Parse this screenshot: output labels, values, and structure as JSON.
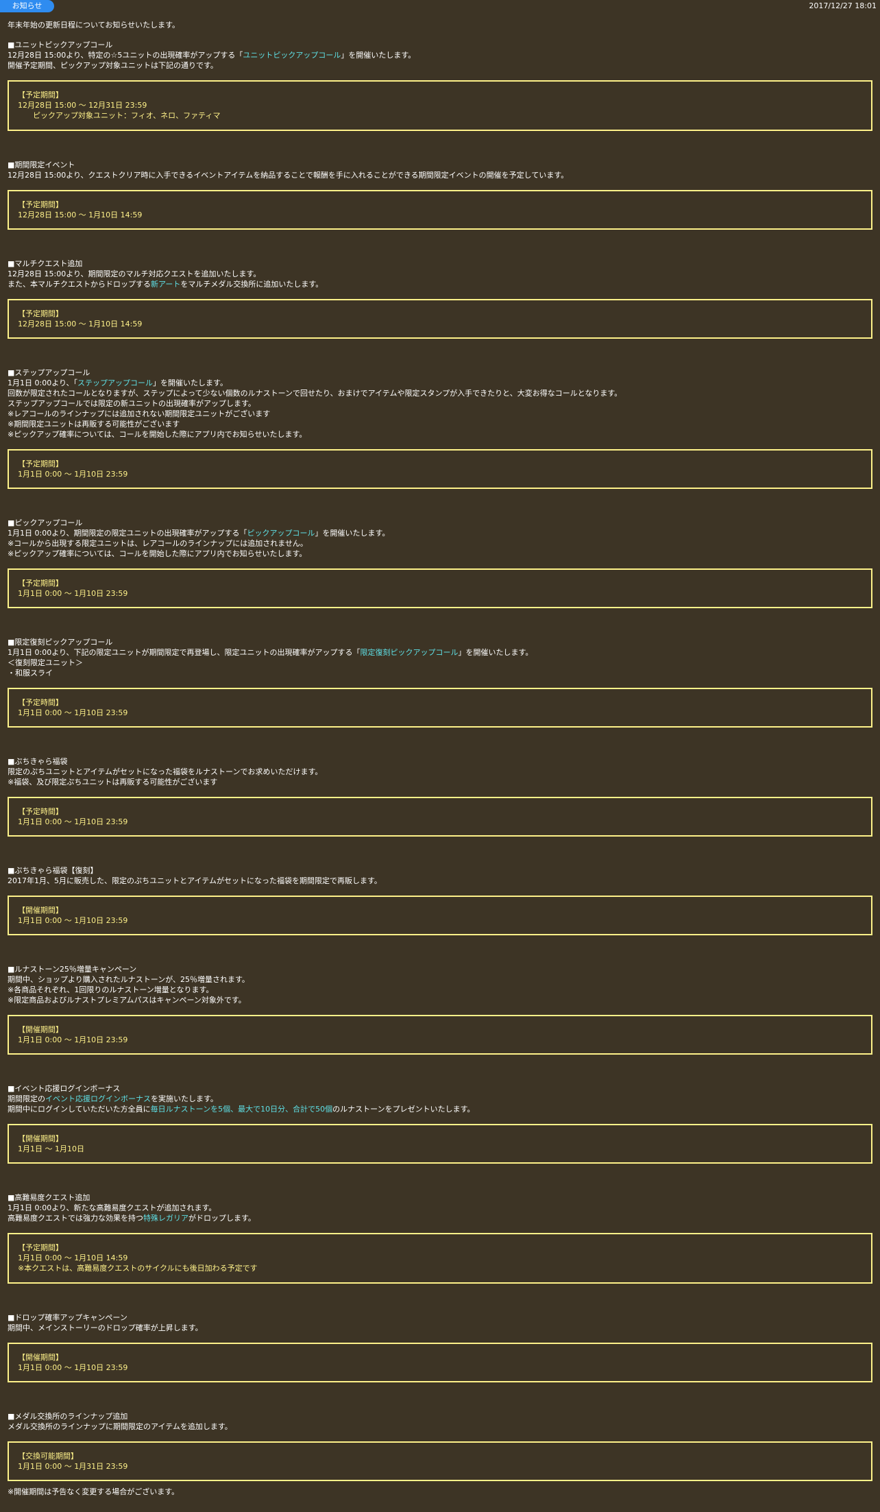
{
  "header": {
    "badge": "お知らせ",
    "timestamp": "2017/12/27 18:01"
  },
  "intro": "年末年始の更新日程についてお知らせいたします。",
  "sections": [
    {
      "title": "■ユニットピックアップコール",
      "lines": [
        [
          {
            "t": "12月28日 15:00より、特定の☆5ユニットの出現確率がアップする「"
          },
          {
            "t": "ユニットピックアップコール",
            "hl": true
          },
          {
            "t": "」を開催いたします。"
          }
        ],
        [
          {
            "t": "開催予定期間、ピックアップ対象ユニットは下記の通りです。"
          }
        ]
      ],
      "box": [
        {
          "t": "【予定期間】"
        },
        {
          "t": "12月28日 15:00 ～ 12月31日 23:59"
        },
        {
          "t": "ピックアップ対象ユニット：フィオ、ネロ、ファティマ",
          "indent": true
        }
      ]
    },
    {
      "title": "■期間限定イベント",
      "lines": [
        [
          {
            "t": "12月28日 15:00より、クエストクリア時に入手できるイベントアイテムを納品することで報酬を手に入れることができる期間限定イベントの開催を予定しています。"
          }
        ]
      ],
      "box": [
        {
          "t": "【予定期間】"
        },
        {
          "t": "12月28日 15:00 ～ 1月10日 14:59"
        }
      ]
    },
    {
      "title": "■マルチクエスト追加",
      "lines": [
        [
          {
            "t": "12月28日 15:00より、期間限定のマルチ対応クエストを追加いたします。"
          }
        ],
        [
          {
            "t": "また、本マルチクエストからドロップする"
          },
          {
            "t": "新アート",
            "hl": true
          },
          {
            "t": "をマルチメダル交換所に追加いたします。"
          }
        ]
      ],
      "box": [
        {
          "t": "【予定期間】"
        },
        {
          "t": "12月28日 15:00 ～ 1月10日 14:59"
        }
      ]
    },
    {
      "title": "■ステップアップコール",
      "lines": [
        [
          {
            "t": "1月1日 0:00より、「"
          },
          {
            "t": "ステップアップコール",
            "hl": true
          },
          {
            "t": "」を開催いたします。"
          }
        ],
        [
          {
            "t": "回数が限定されたコールとなりますが、ステップによって少ない個数のルナストーンで回せたり、おまけでアイテムや限定スタンプが入手できたりと、大変お得なコールとなります。"
          }
        ],
        [
          {
            "t": "ステップアップコールでは限定の新ユニットの出現確率がアップします。"
          }
        ],
        [
          {
            "t": "※レアコールのラインナップには追加されない期間限定ユニットがございます"
          }
        ],
        [
          {
            "t": "※期間限定ユニットは再販する可能性がございます"
          }
        ],
        [
          {
            "t": "※ピックアップ確率については、コールを開始した際にアプリ内でお知らせいたします。"
          }
        ]
      ],
      "box": [
        {
          "t": "【予定期間】"
        },
        {
          "t": "1月1日 0:00 ～ 1月10日 23:59"
        }
      ]
    },
    {
      "title": "■ピックアップコール",
      "lines": [
        [
          {
            "t": "1月1日 0:00より、期間限定の限定ユニットの出現確率がアップする「"
          },
          {
            "t": "ピックアップコール",
            "hl": true
          },
          {
            "t": "」を開催いたします。"
          }
        ],
        [
          {
            "t": "※コールから出現する限定ユニットは、レアコールのラインナップには追加されません。"
          }
        ],
        [
          {
            "t": "※ピックアップ確率については、コールを開始した際にアプリ内でお知らせいたします。"
          }
        ]
      ],
      "box": [
        {
          "t": "【予定期間】"
        },
        {
          "t": "1月1日 0:00 ～ 1月10日 23:59"
        }
      ]
    },
    {
      "title": "■限定復刻ピックアップコール",
      "lines": [
        [
          {
            "t": "1月1日 0:00より、下記の限定ユニットが期間限定で再登場し、限定ユニットの出現確率がアップする「"
          },
          {
            "t": "限定復刻ピックアップコール",
            "hl": true
          },
          {
            "t": "」を開催いたします。"
          }
        ],
        [
          {
            "t": "＜復刻限定ユニット＞"
          }
        ],
        [
          {
            "t": "・和服スライ"
          }
        ]
      ],
      "box": [
        {
          "t": "【予定時間】"
        },
        {
          "t": "1月1日 0:00 ～ 1月10日 23:59"
        }
      ]
    },
    {
      "title": "■ぷちきゃら福袋",
      "lines": [
        [
          {
            "t": "限定のぷちユニットとアイテムがセットになった福袋をルナストーンでお求めいただけます。"
          }
        ],
        [
          {
            "t": "※福袋、及び限定ぷちユニットは再販する可能性がございます"
          }
        ]
      ],
      "box": [
        {
          "t": "【予定時間】"
        },
        {
          "t": "1月1日 0:00 ～ 1月10日 23:59"
        }
      ]
    },
    {
      "title": "■ぷちきゃら福袋【復刻】",
      "lines": [
        [
          {
            "t": "2017年1月、5月に販売した、限定のぷちユニットとアイテムがセットになった福袋を期間限定で再販します。"
          }
        ]
      ],
      "box": [
        {
          "t": "【開催期間】"
        },
        {
          "t": "1月1日 0:00 ～ 1月10日 23:59"
        }
      ]
    },
    {
      "title": "■ルナストーン25％増量キャンペーン",
      "lines": [
        [
          {
            "t": "期間中、ショップより購入されたルナストーンが、25％増量されます。"
          }
        ],
        [
          {
            "t": "※各商品それぞれ、1回限りのルナストーン増量となります。"
          }
        ],
        [
          {
            "t": "※限定商品およびルナストプレミアムパスはキャンペーン対象外です。"
          }
        ]
      ],
      "box": [
        {
          "t": "【開催期間】"
        },
        {
          "t": "1月1日 0:00 ～ 1月10日 23:59"
        }
      ]
    },
    {
      "title": "■イベント応援ログインボーナス",
      "lines": [
        [
          {
            "t": "期間限定の"
          },
          {
            "t": "イベント応援ログインボーナス",
            "hl": true
          },
          {
            "t": "を実施いたします。"
          }
        ],
        [
          {
            "t": "期間中にログインしていただいた方全員に"
          },
          {
            "t": "毎日ルナストーンを5個、最大で10日分、合計で50個",
            "hl": true
          },
          {
            "t": "のルナストーンをプレゼントいたします。"
          }
        ]
      ],
      "box": [
        {
          "t": "【開催期間】"
        },
        {
          "t": "1月1日 ～ 1月10日"
        }
      ]
    },
    {
      "title": "■高難易度クエスト追加",
      "lines": [
        [
          {
            "t": "1月1日 0:00より、新たな高難易度クエストが追加されます。"
          }
        ],
        [
          {
            "t": "高難易度クエストでは強力な効果を持つ"
          },
          {
            "t": "特殊レガリア",
            "hl": true
          },
          {
            "t": "がドロップします。"
          }
        ]
      ],
      "box": [
        {
          "t": "【予定期間】"
        },
        {
          "t": "1月1日 0:00 ～ 1月10日 14:59"
        },
        {
          "t": "※本クエストは、高難易度クエストのサイクルにも後日加わる予定です"
        }
      ]
    },
    {
      "title": "■ドロップ確率アップキャンペーン",
      "lines": [
        [
          {
            "t": "期間中、メインストーリーのドロップ確率が上昇します。"
          }
        ]
      ],
      "box": [
        {
          "t": "【開催期間】"
        },
        {
          "t": "1月1日 0:00 ～ 1月10日 23:59"
        }
      ]
    },
    {
      "title": "■メダル交換所のラインナップ追加",
      "lines": [
        [
          {
            "t": "メダル交換所のラインナップに期間限定のアイテムを追加します。"
          }
        ]
      ],
      "box": [
        {
          "t": "【交換可能期間】"
        },
        {
          "t": "1月1日 0:00 ～ 1月31日 23:59"
        }
      ]
    }
  ],
  "footnote": "※開催期間は予告なく変更する場合がございます。",
  "colors": {
    "background": "#3d3425",
    "text": "#ffffff",
    "highlight": "#5ee0e6",
    "box_border": "#fff28a",
    "badge": "#2f8cf0"
  }
}
